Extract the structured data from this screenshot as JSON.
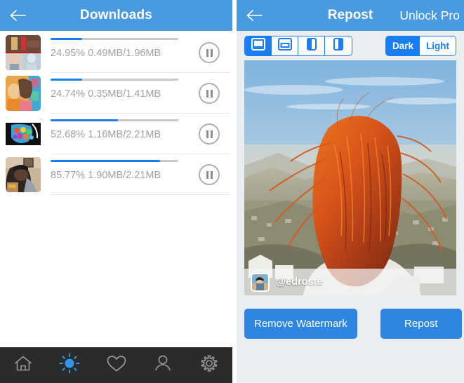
{
  "left_panel": {
    "nav": {
      "back_icon": "back-arrow-icon",
      "title": "Downloads"
    },
    "downloads": [
      {
        "percent_label": "24.95%",
        "sizes_label": "0.49MB/1.96MB",
        "text": "24.95% 0.49MB/1.96MB",
        "progress": 24.95,
        "pause_icon": "pause-icon",
        "thumbnail": "thumbnail-lipstick-collage"
      },
      {
        "percent_label": "24.74%",
        "sizes_label": "0.35MB/1.41MB",
        "text": "24.74% 0.35MB/1.41MB",
        "progress": 24.74,
        "pause_icon": "pause-icon",
        "thumbnail": "thumbnail-woman-and-child"
      },
      {
        "percent_label": "52.68%",
        "sizes_label": "1.16MB/2.21MB",
        "text": "52.68% 1.16MB/2.21MB",
        "progress": 52.68,
        "pause_icon": "pause-icon",
        "thumbnail": "thumbnail-colorful-graphic"
      },
      {
        "percent_label": "85.77%",
        "sizes_label": "1.90MB/2.21MB",
        "text": "85.77% 1.90MB/2.21MB",
        "progress": 85.77,
        "pause_icon": "pause-icon",
        "thumbnail": "thumbnail-man-in-room"
      }
    ],
    "tab_bar": {
      "items": [
        {
          "icon": "home-icon",
          "name": "tab-home",
          "active": false
        },
        {
          "icon": "sun-icon",
          "name": "tab-downloads",
          "active": true
        },
        {
          "icon": "heart-icon",
          "name": "tab-likes",
          "active": false
        },
        {
          "icon": "person-icon",
          "name": "tab-profile",
          "active": false
        },
        {
          "icon": "gear-icon",
          "name": "tab-settings",
          "active": false
        }
      ]
    }
  },
  "right_panel": {
    "nav": {
      "back_icon": "back-arrow-icon",
      "title": "Repost",
      "unlock_label": "Unlock Pro"
    },
    "layout_segment": {
      "options": [
        {
          "icon": "layout-caption-bottom-icon",
          "selected": true
        },
        {
          "icon": "layout-caption-bottom-outline-icon",
          "selected": false
        },
        {
          "icon": "layout-caption-left-icon",
          "selected": false
        },
        {
          "icon": "layout-caption-right-icon",
          "selected": false
        }
      ]
    },
    "theme_segment": {
      "options": [
        {
          "label": "Dark",
          "selected": true
        },
        {
          "label": "Light",
          "selected": false
        }
      ]
    },
    "photo": {
      "alt": "person-with-red-hair-overlooking-city",
      "watermark_username": "@edroste",
      "watermark_avatar": "avatar-icon"
    },
    "actions": {
      "remove_watermark_label": "Remove Watermark",
      "repost_label": "Repost"
    }
  },
  "colors": {
    "nav_blue": "#4a9ae0",
    "accent_blue": "#1b7ef0",
    "button_blue": "#2e86e0",
    "panel_bg": "#eaeef1",
    "tabbar_bg": "#2b2b2b",
    "progress_track": "#c9c9c9",
    "muted_text": "#a3a3a3"
  }
}
